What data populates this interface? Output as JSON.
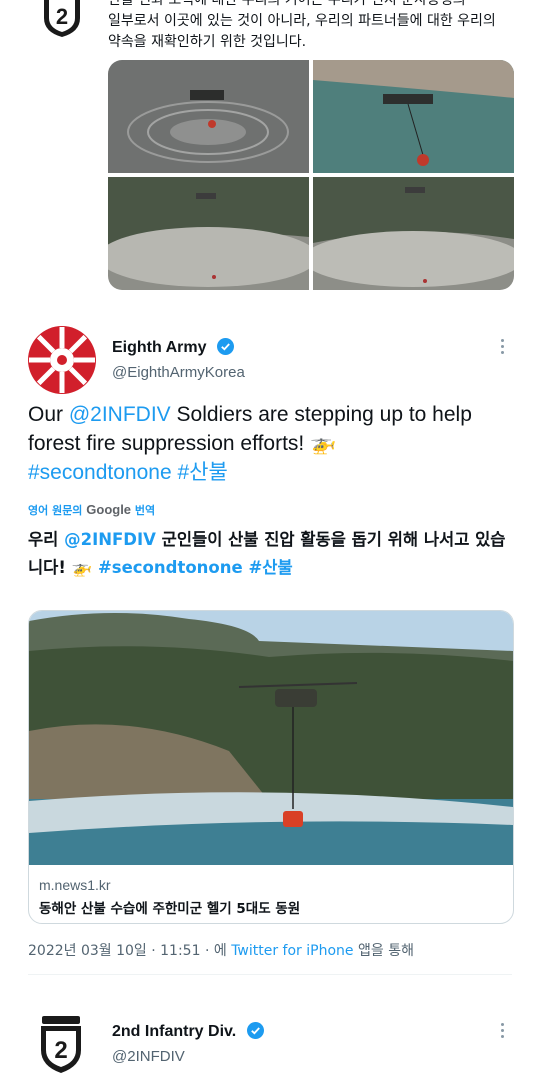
{
  "top_tweet": {
    "lines": [
      "산불 진화 노력에 대한 우리의 기여는 우리가 전지 군사동맹의",
      "일부로서 이곳에 있는 것이 아니라, 우리의 파트너들에 대한 우리의",
      "약속을 재확인하기 위한 것입니다."
    ],
    "images": [
      "helicopter-over-water-ripples",
      "helicopter-with-bucket-over-lake",
      "helicopter-dust-hillside",
      "helicopter-dust-hillside-2"
    ]
  },
  "eighth_army_tweet": {
    "name": "Eighth Army",
    "handle": "@EighthArmyKorea",
    "text_prefix": "Our ",
    "mention": "@2INFDIV",
    "text_middle": " Soldiers are stepping up to help forest fire suppression efforts! ",
    "hashtag1": "#secondtonone",
    "hashtag2": "#산불",
    "translate_prefix": "영어 원문의 ",
    "translate_google": "Google",
    "translate_suffix": " 번역",
    "ko_prefix": "우리 ",
    "ko_mention": "@2INFDIV",
    "ko_middle": " 군인들이 산불 진압 활동을 돕기 위해 나서고 있습니다! ",
    "ko_hashtag1": "#secondtonone",
    "ko_hashtag2": "#산불",
    "card": {
      "domain": "m.news1.kr",
      "title": "동해안 산불 수습에 주한미군 헬기 5대도 동원"
    },
    "meta_date": "2022년 03월 10일 · 11:51 · 에 ",
    "meta_app": "Twitter for iPhone",
    "meta_suffix": " 앱을 통해"
  },
  "bottom_tweet": {
    "name": "2nd Infantry Div.",
    "handle": "@2INFDIV"
  },
  "colors": {
    "accent": "#1d9bf0",
    "secondary_text": "#536471",
    "army_red": "#d11f2b"
  },
  "icons": [
    "verified-badge-icon",
    "more-options-icon",
    "helicopter-emoji-icon"
  ]
}
